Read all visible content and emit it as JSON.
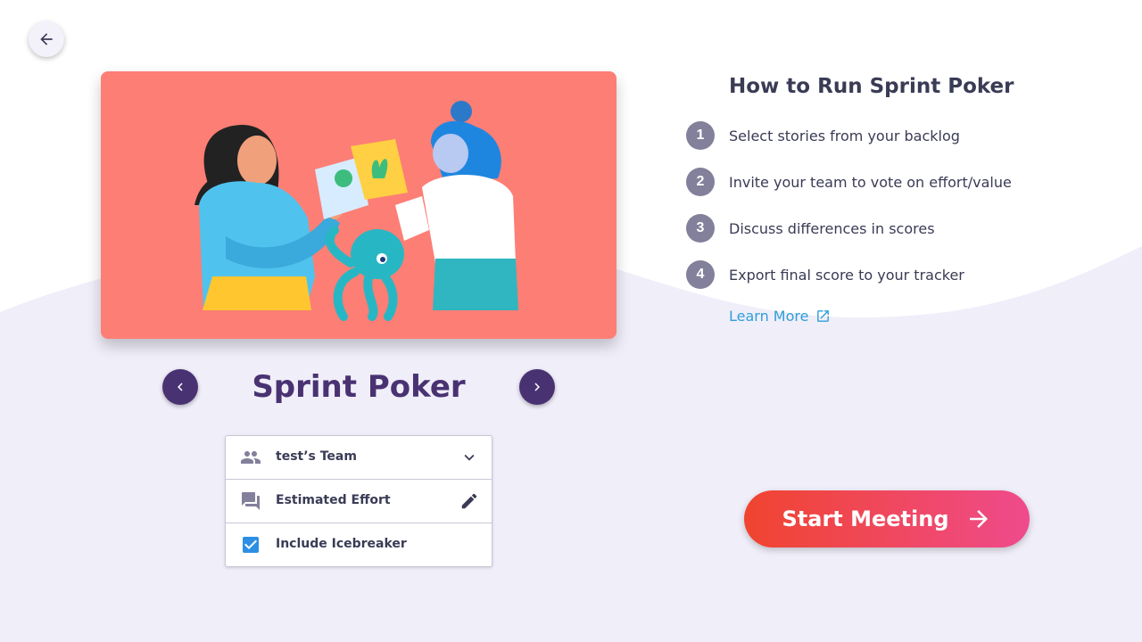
{
  "colors": {
    "page_bg": "#ffffff",
    "wave_bg": "#f0eef9",
    "illustration_bg": "#fd7e75",
    "nav_button": "#493272",
    "title": "#493272",
    "step_badge": "#82809a",
    "link": "#2f9fd8",
    "checkbox": "#2d8fe3",
    "icon": "#82809a",
    "start_gradient_from": "#f0442f",
    "start_gradient_to": "#ef4b8c"
  },
  "header": {
    "back_icon": "arrow-back-icon"
  },
  "carousel": {
    "title": "Sprint Poker",
    "prev_icon": "chevron-left-icon",
    "next_icon": "chevron-right-icon",
    "illustration": "people-with-octopus-illustration"
  },
  "settings": {
    "team": {
      "label": "test’s Team",
      "icon": "group-icon",
      "action_icon": "chevron-down-icon"
    },
    "scale": {
      "label": "Estimated Effort",
      "icon": "forum-icon",
      "action_icon": "pencil-icon"
    },
    "icebreaker": {
      "label": "Include Icebreaker",
      "checked": true,
      "icon": "checkbox-checked-icon"
    }
  },
  "howto": {
    "title": "How to Run Sprint Poker",
    "steps": [
      {
        "number": "1",
        "text": "Select stories from your backlog"
      },
      {
        "number": "2",
        "text": "Invite your team to vote on effort/value"
      },
      {
        "number": "3",
        "text": "Discuss differences in scores"
      },
      {
        "number": "4",
        "text": "Export final score to your tracker"
      }
    ],
    "learn_more": {
      "label": "Learn More",
      "icon": "external-link-icon"
    }
  },
  "start_button": {
    "label": "Start Meeting",
    "icon": "arrow-forward-icon"
  }
}
